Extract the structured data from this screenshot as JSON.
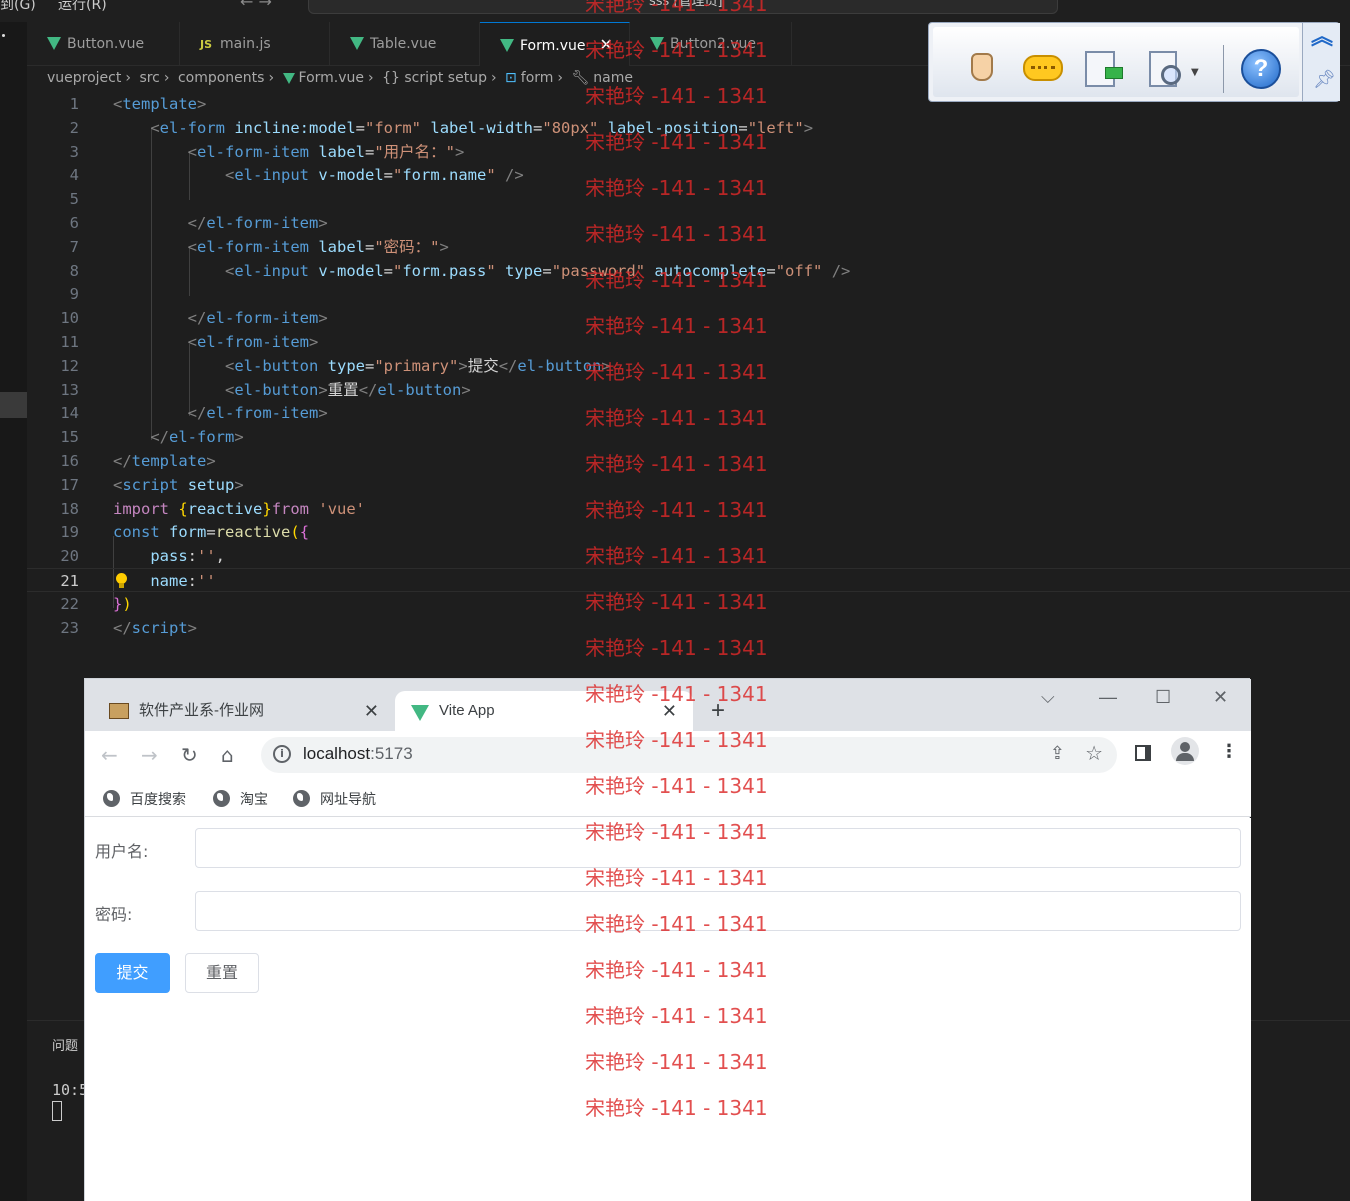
{
  "vscode": {
    "menu": [
      "到(G)",
      "运行(R)"
    ],
    "search_text": "sss [管理员]",
    "tabs": [
      {
        "label": "Button.vue",
        "icon": "vue-icon"
      },
      {
        "label": "main.js",
        "icon": "js-icon",
        "icon_text": "JS"
      },
      {
        "label": "Table.vue",
        "icon": "vue-icon"
      },
      {
        "label": "Form.vue",
        "icon": "vue-icon",
        "active": true
      },
      {
        "label": "Button2.vue",
        "icon": "vue-icon"
      }
    ],
    "breadcrumb": [
      "vueproject",
      "src",
      "components",
      "Form.vue",
      "{} script setup",
      "form",
      "name"
    ],
    "panel_title": "问题",
    "terminal_text": "10:5",
    "colors": {
      "editor_bg": "#1e1e1e",
      "vue_green": "#42b883",
      "tag": "#569cd6",
      "attr": "#9cdcfe",
      "string": "#ce9178"
    }
  },
  "code_lines": [
    {
      "n": "1",
      "tokens": [
        [
          "t-ang",
          "<"
        ],
        [
          "t-tag",
          "template"
        ],
        [
          "t-ang",
          ">"
        ]
      ]
    },
    {
      "n": "2",
      "tokens": [
        [
          "t-ang",
          "    <"
        ],
        [
          "t-tag",
          "el-form"
        ],
        [
          "t-txt",
          " "
        ],
        [
          "t-attr",
          "incline:model"
        ],
        [
          "t-txt",
          "="
        ],
        [
          "t-str",
          "\"form\""
        ],
        [
          "t-txt",
          " "
        ],
        [
          "t-attr",
          "label-width"
        ],
        [
          "t-txt",
          "="
        ],
        [
          "t-str",
          "\"80px\""
        ],
        [
          "t-txt",
          " "
        ],
        [
          "t-attr",
          "label-position"
        ],
        [
          "t-txt",
          "="
        ],
        [
          "t-str",
          "\"left\""
        ],
        [
          "t-ang",
          ">"
        ]
      ]
    },
    {
      "n": "3",
      "tokens": [
        [
          "t-ang",
          "        <"
        ],
        [
          "t-tag",
          "el-form-item"
        ],
        [
          "t-txt",
          " "
        ],
        [
          "t-attr",
          "label"
        ],
        [
          "t-txt",
          "="
        ],
        [
          "t-str",
          "\"用户名：\""
        ],
        [
          "t-ang",
          ">"
        ]
      ]
    },
    {
      "n": "4",
      "tokens": [
        [
          "t-ang",
          "            <"
        ],
        [
          "t-tag",
          "el-input"
        ],
        [
          "t-txt",
          " "
        ],
        [
          "t-attr",
          "v-model"
        ],
        [
          "t-txt",
          "="
        ],
        [
          "t-str",
          "\""
        ],
        [
          "t-var",
          "form.name"
        ],
        [
          "t-str",
          "\""
        ],
        [
          "t-ang",
          " />"
        ]
      ]
    },
    {
      "n": "5",
      "tokens": []
    },
    {
      "n": "6",
      "tokens": [
        [
          "t-ang",
          "        </"
        ],
        [
          "t-tag",
          "el-form-item"
        ],
        [
          "t-ang",
          ">"
        ]
      ]
    },
    {
      "n": "7",
      "tokens": [
        [
          "t-ang",
          "        <"
        ],
        [
          "t-tag",
          "el-form-item"
        ],
        [
          "t-txt",
          " "
        ],
        [
          "t-attr",
          "label"
        ],
        [
          "t-txt",
          "="
        ],
        [
          "t-str",
          "\"密码：\""
        ],
        [
          "t-ang",
          ">"
        ]
      ]
    },
    {
      "n": "8",
      "tokens": [
        [
          "t-ang",
          "            <"
        ],
        [
          "t-tag",
          "el-input"
        ],
        [
          "t-txt",
          " "
        ],
        [
          "t-attr",
          "v-model"
        ],
        [
          "t-txt",
          "="
        ],
        [
          "t-str",
          "\""
        ],
        [
          "t-var",
          "form.pass"
        ],
        [
          "t-str",
          "\""
        ],
        [
          "t-txt",
          " "
        ],
        [
          "t-attr",
          "type"
        ],
        [
          "t-txt",
          "="
        ],
        [
          "t-str",
          "\"password\""
        ],
        [
          "t-txt",
          " "
        ],
        [
          "t-attr",
          "autocomplete"
        ],
        [
          "t-txt",
          "="
        ],
        [
          "t-str",
          "\"off\""
        ],
        [
          "t-ang",
          " />"
        ]
      ]
    },
    {
      "n": "9",
      "tokens": []
    },
    {
      "n": "10",
      "tokens": [
        [
          "t-ang",
          "        </"
        ],
        [
          "t-tag",
          "el-form-item"
        ],
        [
          "t-ang",
          ">"
        ]
      ]
    },
    {
      "n": "11",
      "tokens": [
        [
          "t-ang",
          "        <"
        ],
        [
          "t-tag",
          "el-from-item"
        ],
        [
          "t-ang",
          ">"
        ]
      ]
    },
    {
      "n": "12",
      "tokens": [
        [
          "t-ang",
          "            <"
        ],
        [
          "t-tag",
          "el-button"
        ],
        [
          "t-txt",
          " "
        ],
        [
          "t-attr",
          "type"
        ],
        [
          "t-txt",
          "="
        ],
        [
          "t-str",
          "\"primary\""
        ],
        [
          "t-ang",
          ">"
        ],
        [
          "t-txt",
          "提交"
        ],
        [
          "t-ang",
          "</"
        ],
        [
          "t-tag",
          "el-button"
        ],
        [
          "t-ang",
          ">"
        ]
      ]
    },
    {
      "n": "13",
      "tokens": [
        [
          "t-ang",
          "            <"
        ],
        [
          "t-tag",
          "el-button"
        ],
        [
          "t-ang",
          ">"
        ],
        [
          "t-txt",
          "重置"
        ],
        [
          "t-ang",
          "</"
        ],
        [
          "t-tag",
          "el-button"
        ],
        [
          "t-ang",
          ">"
        ]
      ]
    },
    {
      "n": "14",
      "tokens": [
        [
          "t-ang",
          "        </"
        ],
        [
          "t-tag",
          "el-from-item"
        ],
        [
          "t-ang",
          ">"
        ]
      ]
    },
    {
      "n": "15",
      "tokens": [
        [
          "t-ang",
          "    </"
        ],
        [
          "t-tag",
          "el-form"
        ],
        [
          "t-ang",
          ">"
        ]
      ]
    },
    {
      "n": "16",
      "tokens": [
        [
          "t-ang",
          "</"
        ],
        [
          "t-tag",
          "template"
        ],
        [
          "t-ang",
          ">"
        ]
      ]
    },
    {
      "n": "17",
      "tokens": [
        [
          "t-ang",
          "<"
        ],
        [
          "t-tag",
          "script"
        ],
        [
          "t-txt",
          " "
        ],
        [
          "t-attr",
          "setup"
        ],
        [
          "t-ang",
          ">"
        ]
      ]
    },
    {
      "n": "18",
      "tokens": [
        [
          "t-kw",
          "import"
        ],
        [
          "t-txt",
          " "
        ],
        [
          "t-br",
          "{"
        ],
        [
          "t-var",
          "reactive"
        ],
        [
          "t-br",
          "}"
        ],
        [
          "t-kw",
          "from"
        ],
        [
          "t-txt",
          " "
        ],
        [
          "t-str",
          "'vue'"
        ]
      ]
    },
    {
      "n": "19",
      "tokens": [
        [
          "t-decl",
          "const"
        ],
        [
          "t-txt",
          " "
        ],
        [
          "t-var",
          "form"
        ],
        [
          "t-txt",
          "="
        ],
        [
          "t-fn",
          "reactive"
        ],
        [
          "t-br",
          "("
        ],
        [
          "t-br2",
          "{"
        ]
      ]
    },
    {
      "n": "20",
      "tokens": [
        [
          "t-txt",
          "    "
        ],
        [
          "t-var",
          "pass"
        ],
        [
          "t-txt",
          ":"
        ],
        [
          "t-str",
          "''"
        ],
        [
          "t-txt",
          ","
        ]
      ]
    },
    {
      "n": "21",
      "tokens": [
        [
          "t-txt",
          "    "
        ],
        [
          "t-var",
          "name"
        ],
        [
          "t-txt",
          ":"
        ],
        [
          "t-str",
          "''"
        ]
      ],
      "current": true
    },
    {
      "n": "22",
      "tokens": [
        [
          "t-br2",
          "}"
        ],
        [
          "t-br",
          ")"
        ]
      ]
    },
    {
      "n": "23",
      "tokens": [
        [
          "t-ang",
          "</"
        ],
        [
          "t-tag",
          "script"
        ],
        [
          "t-ang",
          ">"
        ]
      ]
    }
  ],
  "browser": {
    "tabs": [
      {
        "title": "软件产业系-作业网"
      },
      {
        "title": "Vite App",
        "active": true
      }
    ],
    "url_host": "localhost",
    "url_port": ":5173",
    "bookmarks": [
      "百度搜索",
      "淘宝",
      "网址导航"
    ],
    "form": {
      "username_label": "用户名:",
      "password_label": "密码:",
      "submit_label": "提交",
      "reset_label": "重置"
    },
    "colors": {
      "primary": "#409eff",
      "label": "#606266",
      "border": "#dcdfe6"
    }
  },
  "toolbar_icons": [
    "hand-icon",
    "comment-icon",
    "export-document-icon",
    "search-document-icon",
    "help-icon",
    "collapse-chevron-icon",
    "pin-icon"
  ],
  "toolbar_help_glyph": "?",
  "watermark": {
    "text": "宋艳玲 -141 - 1341",
    "count": 25,
    "color": "#dc2828"
  }
}
